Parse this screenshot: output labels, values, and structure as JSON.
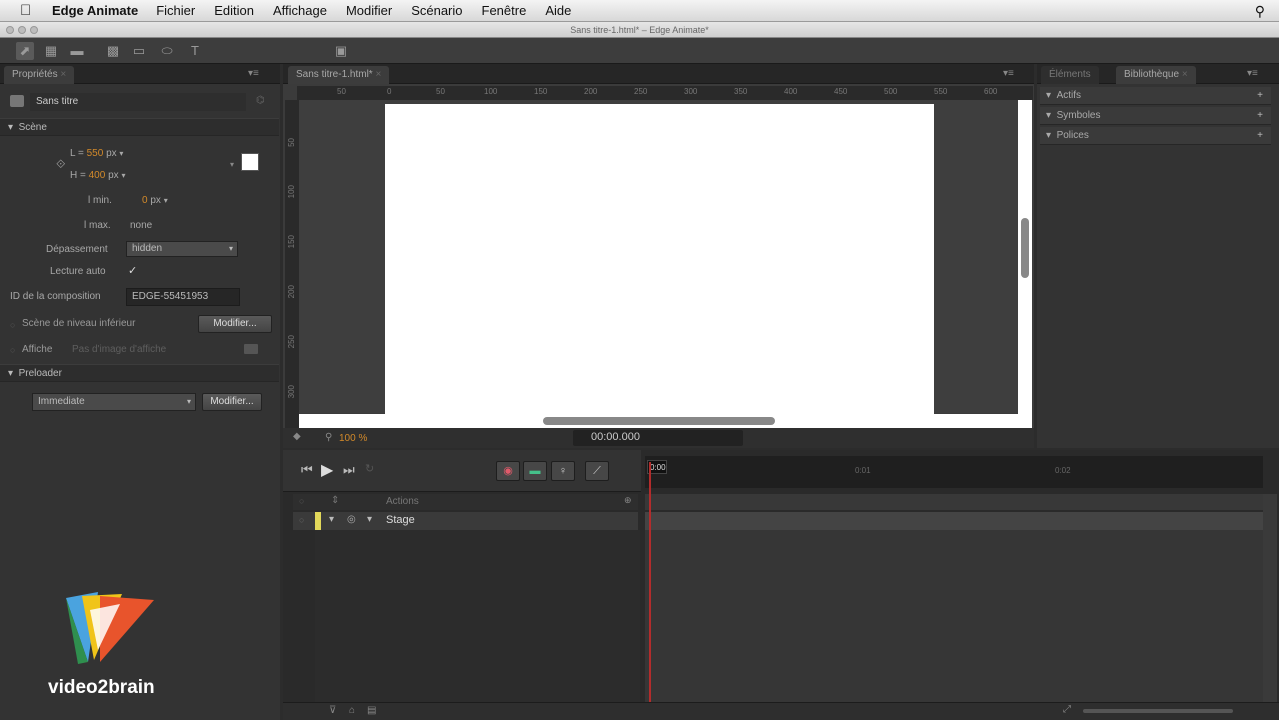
{
  "menubar": {
    "app_name": "Edge Animate",
    "items": [
      "Fichier",
      "Edition",
      "Affichage",
      "Modifier",
      "Scénario",
      "Fenêtre",
      "Aide"
    ]
  },
  "window": {
    "title": "Sans titre-1.html* – Edge Animate*"
  },
  "properties": {
    "tab_label": "Propriétés",
    "element_name": "Sans titre",
    "scene_section": "Scène",
    "width_label": "L =",
    "width_value": "550",
    "height_label": "H =",
    "height_value": "400",
    "unit": "px",
    "min_width_label": "l min.",
    "min_width_value": "0",
    "max_width_label": "l max.",
    "max_width_value": "none",
    "overflow_label": "Dépassement",
    "overflow_value": "hidden",
    "autoplay_label": "Lecture auto",
    "autoplay_check": "✓",
    "composition_id_label": "ID de la composition",
    "composition_id_value": "EDGE-55451953",
    "down_level_label": "Scène de niveau inférieur",
    "modify_button": "Modifier...",
    "poster_label": "Affiche",
    "poster_placeholder": "Pas d'image d'affiche",
    "preloader_section": "Preloader",
    "preloader_value": "Immediate",
    "preloader_modify": "Modifier..."
  },
  "stage": {
    "tab_label": "Sans titre-1.html*",
    "ruler_h": [
      "50",
      "0",
      "50",
      "100",
      "150",
      "200",
      "250",
      "300",
      "350",
      "400",
      "450",
      "500",
      "550",
      "600"
    ],
    "ruler_v": [
      "50",
      "100",
      "150",
      "200",
      "250",
      "300"
    ],
    "zoom": "100 %",
    "time": "00:00.000"
  },
  "library": {
    "tab_elements": "Éléments",
    "tab_library": "Bibliothèque",
    "rows": [
      "Actifs",
      "Symboles",
      "Polices"
    ]
  },
  "timeline": {
    "actions_label": "Actions",
    "stage_label": "Stage",
    "playhead": "0:00",
    "marks": [
      "0:01",
      "0:02"
    ]
  },
  "brand": {
    "name": "video2brain"
  }
}
